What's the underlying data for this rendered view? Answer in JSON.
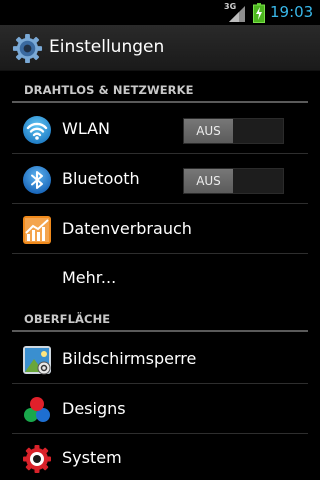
{
  "status_bar": {
    "network_type": "3G",
    "time": "19:03",
    "icons": [
      "signal-icon",
      "battery-charging-icon"
    ]
  },
  "action_bar": {
    "icon": "settings-gear-icon",
    "title": "Einstellungen"
  },
  "sections": [
    {
      "header": "DRAHTLOS & NETZWERKE",
      "items": [
        {
          "label": "WLAN",
          "icon": "wifi-icon",
          "toggle": "AUS"
        },
        {
          "label": "Bluetooth",
          "icon": "bluetooth-icon",
          "toggle": "AUS"
        },
        {
          "label": "Datenverbrauch",
          "icon": "data-usage-icon"
        },
        {
          "label": "Mehr..."
        }
      ]
    },
    {
      "header": "OBERFLÄCHE",
      "items": [
        {
          "label": "Bildschirmsperre",
          "icon": "lock-screen-icon"
        },
        {
          "label": "Designs",
          "icon": "designs-icon"
        },
        {
          "label": "System",
          "icon": "system-icon"
        }
      ]
    }
  ],
  "colors": {
    "accent": "#39b7e8",
    "background": "#000000",
    "toggle_off": "#6a6a6a"
  }
}
